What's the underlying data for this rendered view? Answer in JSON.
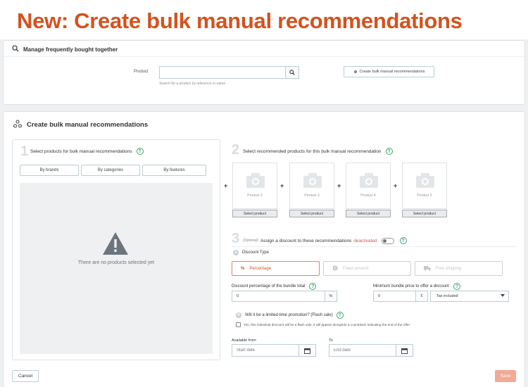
{
  "banner": {
    "title": "New:  Create bulk manual recommendations"
  },
  "manage": {
    "header": "Manage frequently bought together",
    "product_label": "Product",
    "search_placeholder": "",
    "search_hint": "Search for a product by reference or name",
    "create_button": "Create bulk manual recommendations"
  },
  "bulk": {
    "header": "Create bulk manual recommendations",
    "step1": {
      "number": "1",
      "title": "Select products for bulk manual recommendations",
      "filters": [
        "By brands",
        "By categories",
        "By features"
      ],
      "empty_text": "There are no products selected yet"
    },
    "step2": {
      "number": "2",
      "title": "Select recommended products for this bulk manual recommendation",
      "products": [
        {
          "label": "Product 2",
          "button": "Select product"
        },
        {
          "label": "Product 3",
          "button": "Select product"
        },
        {
          "label": "Product 4",
          "button": "Select product"
        },
        {
          "label": "Product 5",
          "button": "Select product"
        }
      ],
      "plus": "+"
    },
    "step3": {
      "number": "3",
      "optional": "(Optional)",
      "title": "Assign a discount to these recommendations",
      "status": "deactivated",
      "discount_type_letter": "A",
      "discount_type_label": "Discount Type",
      "types": [
        "Percentage",
        "Fixed amount",
        "Free shipping"
      ],
      "pct_label": "Discount percentage of the bundle total",
      "pct_value": "0",
      "pct_unit": "%",
      "min_label": "Minimum bundle price to offer a discount",
      "min_value": "0",
      "min_unit": "€",
      "tax_option": "Tax included",
      "flash_letter": "B",
      "flash_title": "Will it be a limited-time promotion? (Flash sale)",
      "flash_text": "Yes, this individual discount will be a flash sale, it will appear alongside a countdown indicating the end of the offer.",
      "from_label": "Available from",
      "from_placeholder": "Start date",
      "to_label": "To",
      "to_placeholder": "End date"
    }
  },
  "footer": {
    "cancel": "Cancel",
    "save": "Save"
  },
  "colors": {
    "brand": "#d4521e",
    "help": "#3ba56d",
    "save": "#f2a995",
    "deactivated": "#d9534f"
  }
}
